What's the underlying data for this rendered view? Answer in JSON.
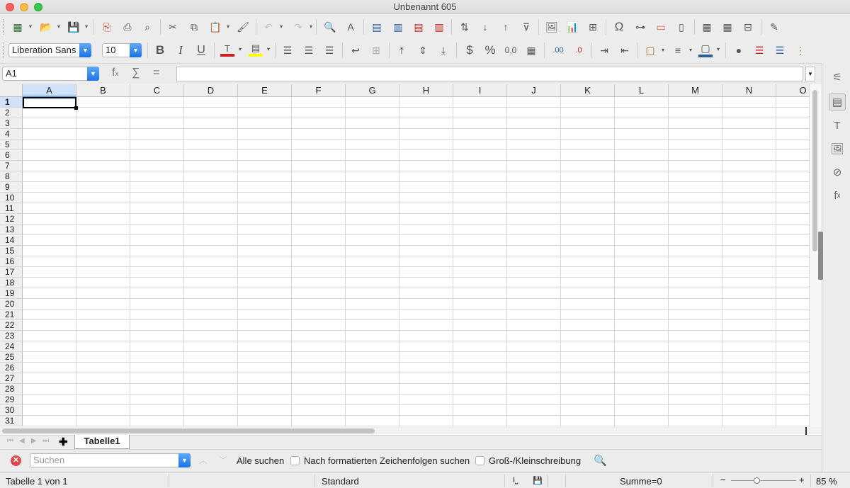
{
  "window": {
    "title": "Unbenannt 605"
  },
  "toolbar1": {
    "icons": [
      "new-spreadsheet-icon",
      "open-icon",
      "save-icon",
      "export-pdf-icon",
      "print-icon",
      "print-preview-icon",
      "cut-icon",
      "copy-icon",
      "paste-icon",
      "clone-formatting-icon",
      "undo-icon",
      "redo-icon",
      "find-replace-icon",
      "spelling-icon",
      "row-icon",
      "column-icon",
      "insert-rows-icon",
      "delete-rows-icon",
      "sort-icon",
      "sort-ascending-icon",
      "sort-descending-icon",
      "autofilter-icon",
      "image-icon",
      "chart-icon",
      "pivot-table-icon",
      "special-character-icon",
      "hyperlink-icon",
      "comment-icon",
      "headers-footers-icon",
      "define-print-area-icon",
      "freeze-icon",
      "split-window-icon",
      "show-draw-functions-icon"
    ]
  },
  "toolbar2": {
    "font_name": "Liberation Sans",
    "font_size": "10",
    "font_color": "#c9211e",
    "highlight_color": "#ffff00",
    "border_color": "#2a6099"
  },
  "formula_bar": {
    "name_box": "A1",
    "content": ""
  },
  "grid": {
    "columns": [
      "A",
      "B",
      "C",
      "D",
      "E",
      "F",
      "G",
      "H",
      "I",
      "J",
      "K",
      "L",
      "M",
      "N",
      "O"
    ],
    "rows": [
      "1",
      "2",
      "3",
      "4",
      "5",
      "6",
      "7",
      "8",
      "9",
      "10",
      "11",
      "12",
      "13",
      "14",
      "15",
      "16",
      "17",
      "18",
      "19",
      "20",
      "21",
      "22",
      "23",
      "24",
      "25",
      "26",
      "27",
      "28",
      "29",
      "30",
      "31"
    ],
    "selected_column": "A",
    "selected_row": "1"
  },
  "sheets": {
    "tabs": [
      "Tabelle1"
    ],
    "active": "Tabelle1"
  },
  "find_bar": {
    "search_placeholder": "Suchen",
    "find_all_label": "Alle suchen",
    "formatted_label": "Nach formatierten Zeichenfolgen suchen",
    "case_label": "Groß-/Kleinschreibung"
  },
  "status_bar": {
    "sheet_info": "Tabelle 1 von 1",
    "page_style": "Standard",
    "sum": "Summe=0",
    "zoom": "85 %"
  }
}
